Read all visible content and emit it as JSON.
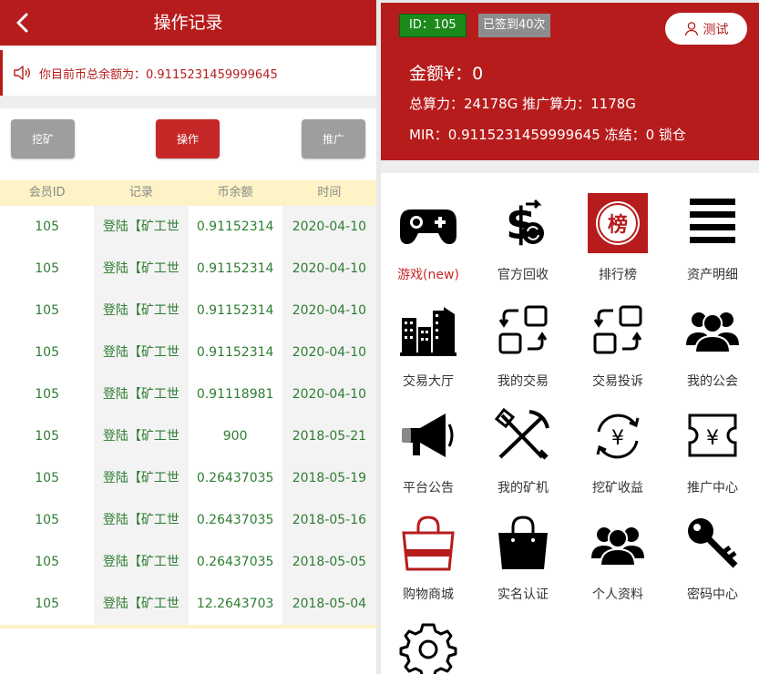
{
  "left": {
    "header": {
      "title": "操作记录"
    },
    "notice": {
      "text": "你目前币总余额为：0.9115231459999645"
    },
    "buttons": {
      "mine": "挖矿",
      "operate": "操作",
      "promote": "推广"
    },
    "table": {
      "columns": [
        "会员ID",
        "记录",
        "币余额",
        "时间"
      ],
      "rows": [
        [
          "105",
          "登陆【矿工世",
          "0.91152314",
          "2020-04-10"
        ],
        [
          "105",
          "登陆【矿工世",
          "0.91152314",
          "2020-04-10"
        ],
        [
          "105",
          "登陆【矿工世",
          "0.91152314",
          "2020-04-10"
        ],
        [
          "105",
          "登陆【矿工世",
          "0.91152314",
          "2020-04-10"
        ],
        [
          "105",
          "登陆【矿工世",
          "0.91118981",
          "2020-04-10"
        ],
        [
          "105",
          "登陆【矿工世",
          "900",
          "2018-05-21"
        ],
        [
          "105",
          "登陆【矿工世",
          "0.26437035",
          "2018-05-19"
        ],
        [
          "105",
          "登陆【矿工世",
          "0.26437035",
          "2018-05-16"
        ],
        [
          "105",
          "登陆【矿工世",
          "0.26437035",
          "2018-05-05"
        ],
        [
          "105",
          "登陆【矿工世",
          "12.2643703",
          "2018-05-04"
        ]
      ]
    }
  },
  "right": {
    "id_badge": "ID：105",
    "sign_badge": "已签到40次",
    "user_button": "测试",
    "amount": "金额¥：0",
    "power": "总算力：24178G 推广算力：1178G",
    "mir": "MIR：0.9115231459999645 冻结：0 锁仓",
    "menu": [
      {
        "label": "游戏(new)",
        "icon": "gamepad-icon"
      },
      {
        "label": "官方回收",
        "icon": "dollar-recycle-icon"
      },
      {
        "label": "排行榜",
        "icon": "ranking-badge-icon"
      },
      {
        "label": "资产明细",
        "icon": "list-lines-icon"
      },
      {
        "label": "交易大厅",
        "icon": "buildings-icon"
      },
      {
        "label": "我的交易",
        "icon": "exchange-icon"
      },
      {
        "label": "交易投诉",
        "icon": "exchange-icon"
      },
      {
        "label": "我的公会",
        "icon": "group-icon"
      },
      {
        "label": "平台公告",
        "icon": "megaphone-icon"
      },
      {
        "label": "我的矿机",
        "icon": "pickaxe-shovel-icon"
      },
      {
        "label": "挖矿收益",
        "icon": "yen-cycle-icon"
      },
      {
        "label": "推广中心",
        "icon": "yen-ticket-icon"
      },
      {
        "label": "购物商城",
        "icon": "shopping-bag-outline-icon"
      },
      {
        "label": "实名认证",
        "icon": "shopping-bag-filled-icon"
      },
      {
        "label": "个人资料",
        "icon": "people-icon"
      },
      {
        "label": "密码中心",
        "icon": "key-icon"
      },
      {
        "label": "",
        "icon": "gear-icon"
      }
    ],
    "colors": {
      "brand": "#b71c1c",
      "id_badge": "#1b8a1b",
      "text_green": "#2e7d32"
    }
  }
}
